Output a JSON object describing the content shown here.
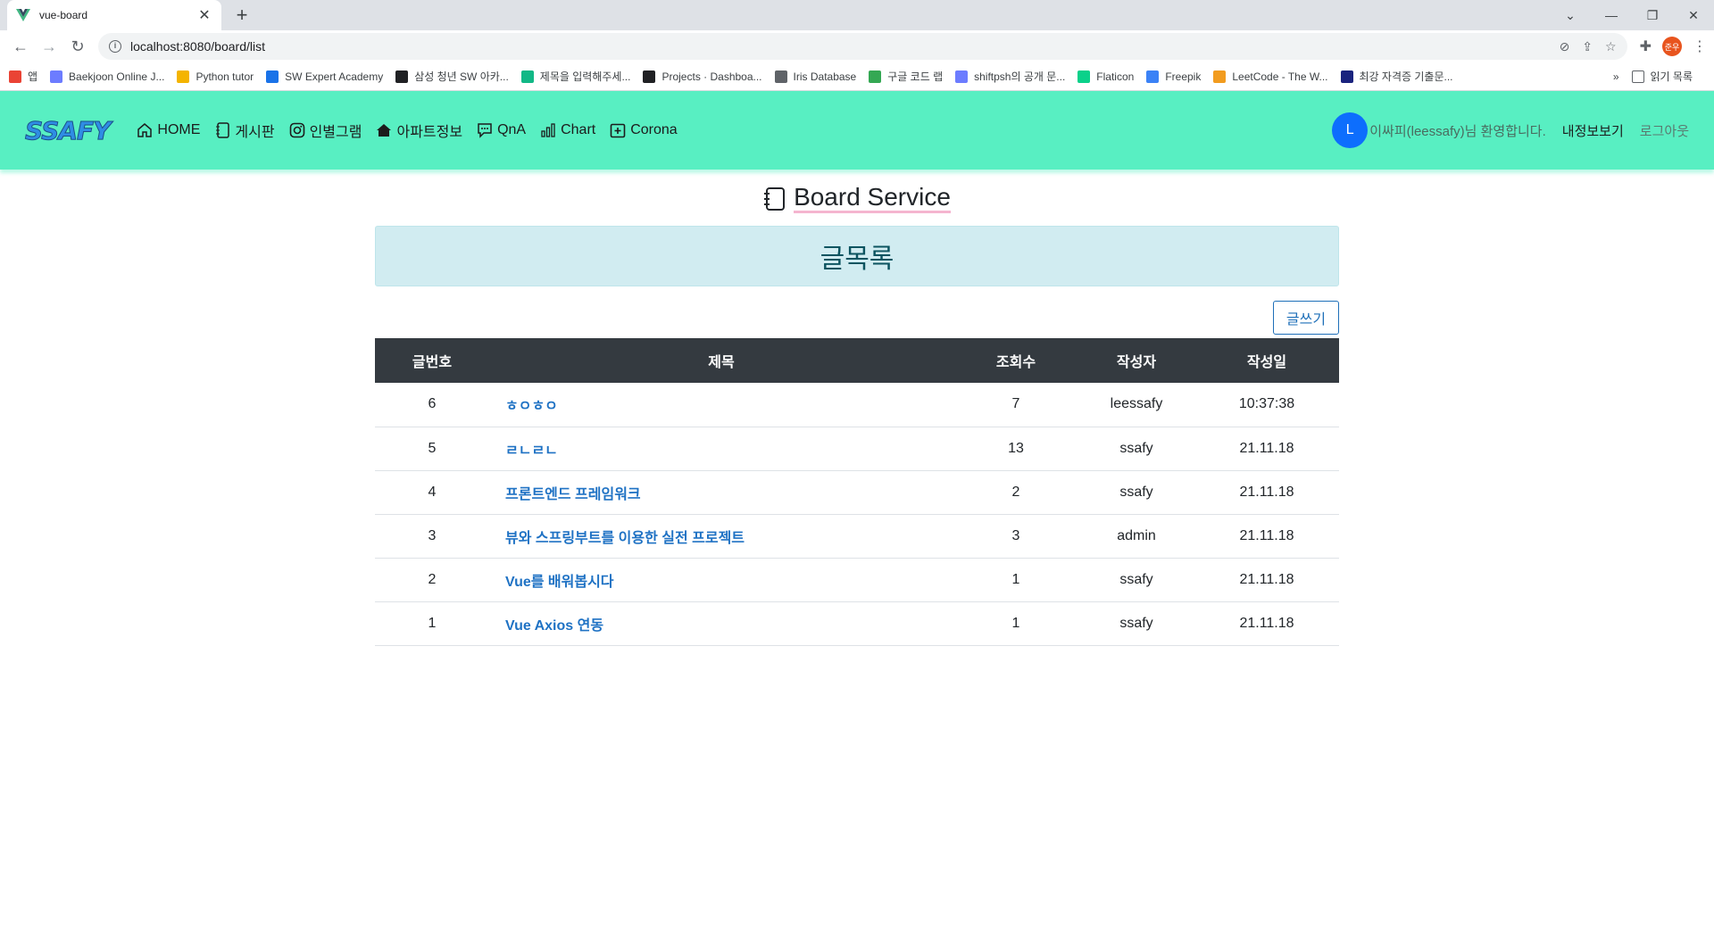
{
  "browser": {
    "tab_title": "vue-board",
    "url": "localhost:8080/board/list",
    "profile_initials": "준우",
    "bookmarks": [
      {
        "label": "앱",
        "icon": "apps-icon"
      },
      {
        "label": "Baekjoon Online J...",
        "icon": "code-icon"
      },
      {
        "label": "Python tutor",
        "icon": "python-icon"
      },
      {
        "label": "SW Expert Academy",
        "icon": "swea-icon"
      },
      {
        "label": "삼성 청년 SW 아카...",
        "icon": "ssafy-icon"
      },
      {
        "label": "제목을 입력해주세...",
        "icon": "m-icon"
      },
      {
        "label": "Projects · Dashboa...",
        "icon": "gitlab-icon"
      },
      {
        "label": "Iris Database",
        "icon": "globe-icon"
      },
      {
        "label": "구글 코드 랩",
        "icon": "codelab-icon"
      },
      {
        "label": "shiftpsh의 공개 문...",
        "icon": "code-icon"
      },
      {
        "label": "Flaticon",
        "icon": "flaticon-icon"
      },
      {
        "label": "Freepik",
        "icon": "freepik-icon"
      },
      {
        "label": "LeetCode - The W...",
        "icon": "leetcode-icon"
      },
      {
        "label": "최강 자격증 기출문...",
        "icon": "gsc-icon"
      }
    ],
    "more_label": "»",
    "reading_list_label": "읽기 목록"
  },
  "navbar": {
    "logo": "SSAFY",
    "links": [
      {
        "label": "HOME",
        "icon": "house-icon"
      },
      {
        "label": "게시판",
        "icon": "journal-icon"
      },
      {
        "label": "인별그램",
        "icon": "instagram-icon"
      },
      {
        "label": "아파트정보",
        "icon": "house-fill-icon"
      },
      {
        "label": "QnA",
        "icon": "chat-dots-icon"
      },
      {
        "label": "Chart",
        "icon": "bar-chart-icon"
      },
      {
        "label": "Corona",
        "icon": "plus-square-icon"
      }
    ],
    "avatar_letter": "L",
    "welcome": "이싸피(leessafy)님 환영합니다.",
    "myinfo": "내정보보기",
    "logout": "로그아웃"
  },
  "page": {
    "title": "Board Service",
    "alert": "글목록",
    "write_button": "글쓰기"
  },
  "table": {
    "headers": [
      "글번호",
      "제목",
      "조회수",
      "작성자",
      "작성일"
    ],
    "rows": [
      {
        "no": "6",
        "subject": "ㅎㅇㅎㅇ",
        "hit": "7",
        "writer": "leessafy",
        "date": "10:37:38"
      },
      {
        "no": "5",
        "subject": "ㄹㄴㄹㄴ",
        "hit": "13",
        "writer": "ssafy",
        "date": "21.11.18"
      },
      {
        "no": "4",
        "subject": "프론트엔드 프레임워크",
        "hit": "2",
        "writer": "ssafy",
        "date": "21.11.18"
      },
      {
        "no": "3",
        "subject": "뷰와 스프링부트를 이용한 실전 프로젝트",
        "hit": "3",
        "writer": "admin",
        "date": "21.11.18"
      },
      {
        "no": "2",
        "subject": "Vue를 배워봅시다",
        "hit": "1",
        "writer": "ssafy",
        "date": "21.11.18"
      },
      {
        "no": "1",
        "subject": "Vue Axios 연동",
        "hit": "1",
        "writer": "ssafy",
        "date": "21.11.18"
      }
    ]
  }
}
